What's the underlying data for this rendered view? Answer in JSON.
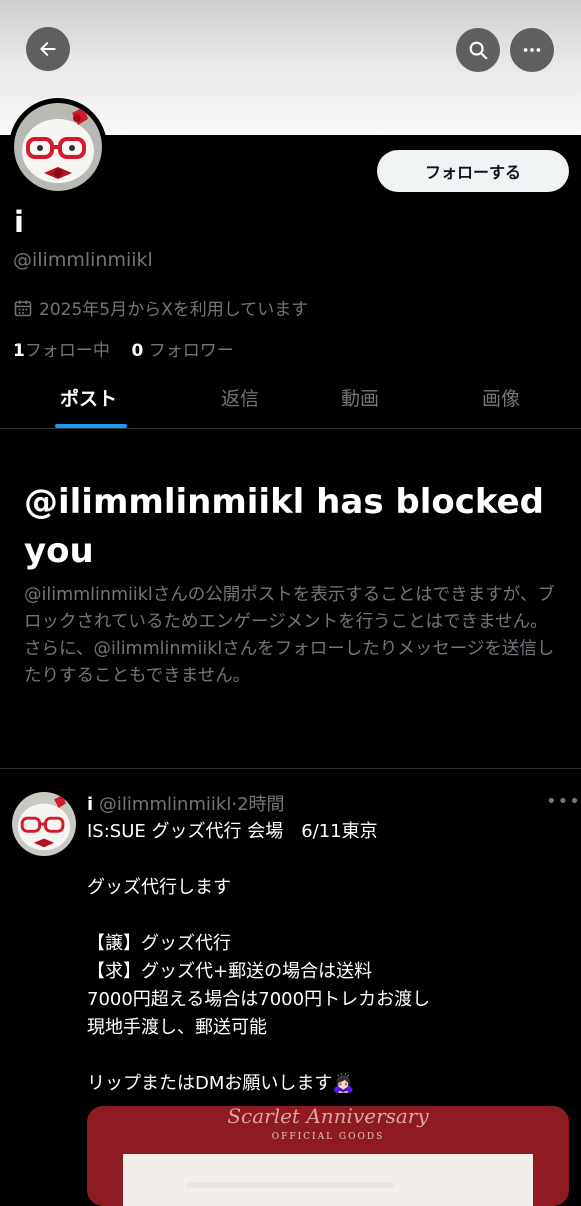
{
  "profile": {
    "display_name": "i",
    "handle": "@ilimmlinmiikl",
    "joined": "2025年5月からXを利用しています",
    "following_count": "1",
    "following_label": "フォロー中",
    "followers_count": "0",
    "followers_label": "フォロワー",
    "follow_button": "フォローする"
  },
  "tabs": [
    {
      "label": "ポスト",
      "active": true
    },
    {
      "label": "返信",
      "active": false
    },
    {
      "label": "動画",
      "active": false
    },
    {
      "label": "画像",
      "active": false
    }
  ],
  "blocked": {
    "title": "@ilimmlinmiikl has blocked you",
    "description": "@ilimmlinmiiklさんの公開ポストを表示することはできますが、ブロックされているためエンゲージメントを行うことはできません。さらに、@ilimmlinmiiklさんをフォローしたりメッセージを送信したりすることもできません。"
  },
  "post": {
    "name": "i",
    "handle": "@ilimmlinmiikl",
    "separator": "·",
    "time": "2時間",
    "lines": [
      "IS:SUE グッズ代行 会場　6/11東京",
      "",
      "グッズ代行します",
      "",
      "【譲】グッズ代行",
      "【求】グッズ代+郵送の場合は送料",
      "7000円超える場合は7000円トレカお渡し",
      "現地手渡し、郵送可能",
      "",
      "リップまたはDMお願いします🙇🏻‍♀️"
    ],
    "media_text": {
      "script": "Scarlet Anniversary",
      "heading": "OFFICIAL GOODS"
    }
  },
  "icons": {
    "back": "arrow-left-icon",
    "search": "search-icon",
    "more": "more-horizontal-icon",
    "calendar": "calendar-icon"
  },
  "colors": {
    "accent": "#1d9bf0",
    "background": "#000000",
    "secondary_text": "#71767b"
  }
}
